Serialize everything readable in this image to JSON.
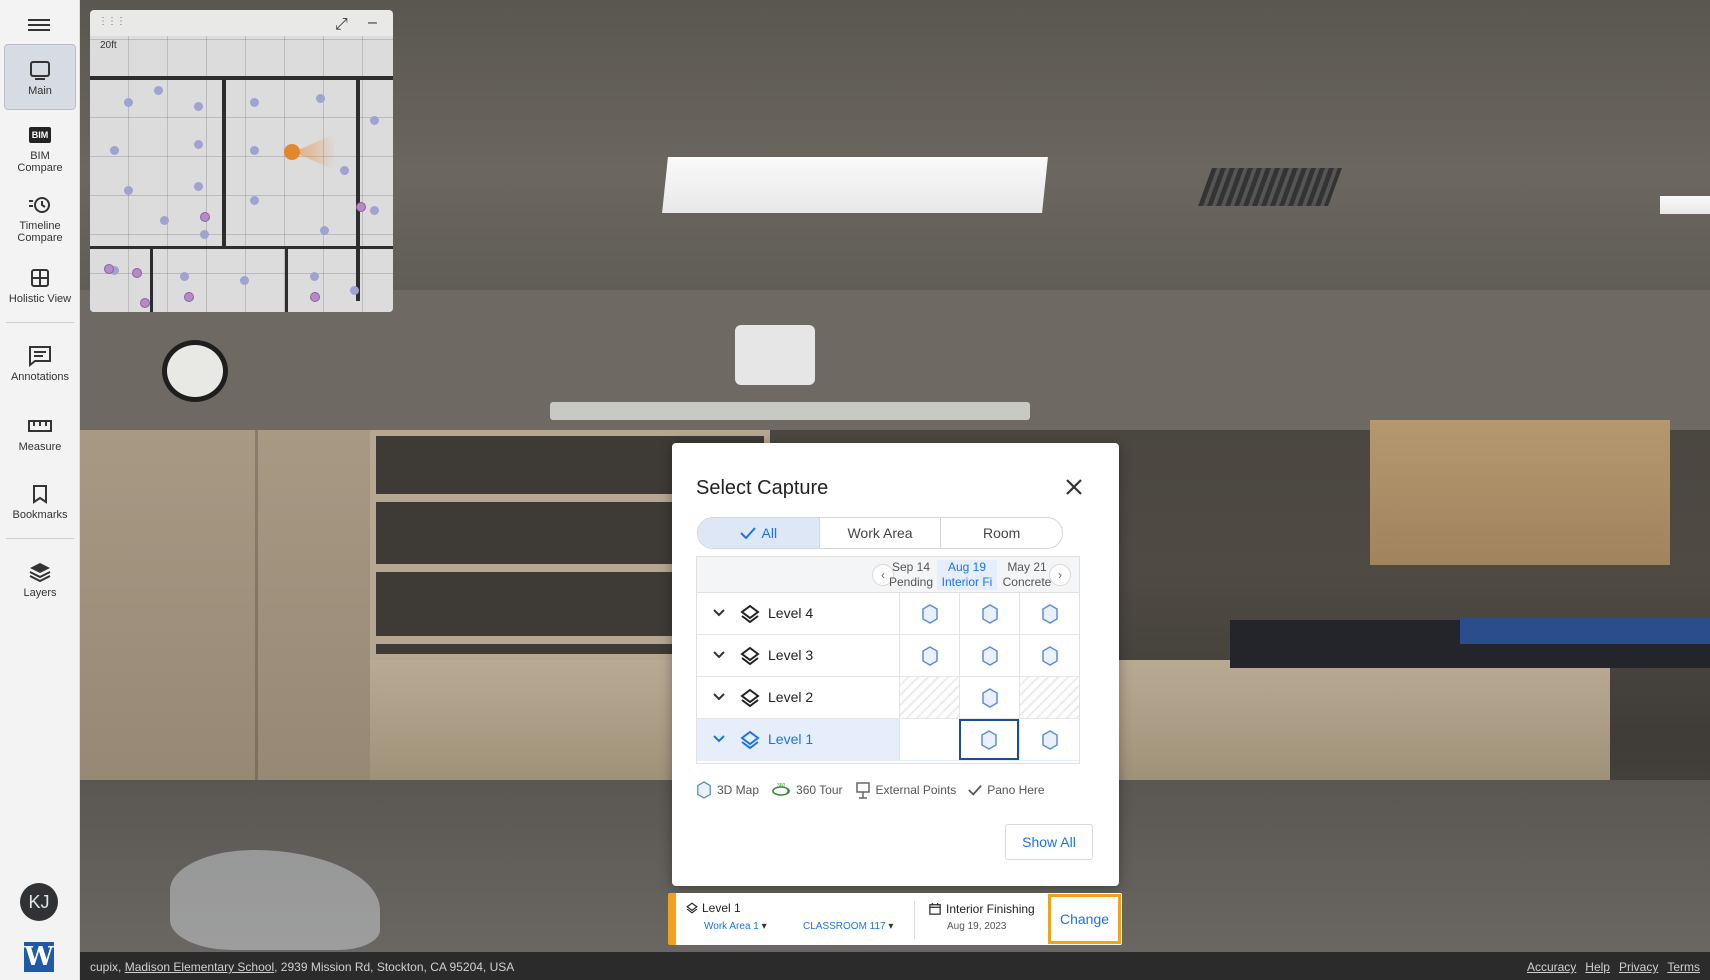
{
  "sidebar": {
    "items": [
      {
        "label": "Main",
        "icon": "square-icon"
      },
      {
        "label": "BIM\nCompare",
        "icon": "bim-icon",
        "badge": "BIM"
      },
      {
        "label": "Timeline\nCompare",
        "icon": "timeline-icon"
      },
      {
        "label": "Holistic View",
        "icon": "grid-icon"
      },
      {
        "label": "Annotations",
        "icon": "annotation-icon"
      },
      {
        "label": "Measure",
        "icon": "ruler-icon"
      },
      {
        "label": "Bookmarks",
        "icon": "bookmark-icon"
      },
      {
        "label": "Layers",
        "icon": "layers-icon"
      }
    ],
    "avatar": "KJ",
    "logo": "W"
  },
  "minimap": {
    "scale_label": "20ft"
  },
  "modal": {
    "title": "Select Capture",
    "tabs": [
      {
        "label": "All",
        "active": true
      },
      {
        "label": "Work Area",
        "active": false
      },
      {
        "label": "Room",
        "active": false
      }
    ],
    "columns": [
      {
        "date": "Sep 14",
        "phase": "Pending",
        "selected": false
      },
      {
        "date": "Aug 19",
        "phase": "Interior Fi",
        "selected": true
      },
      {
        "date": "May 21",
        "phase": "Concrete",
        "selected": false
      }
    ],
    "rows": [
      {
        "label": "Level 4",
        "cells": [
          "map",
          "map",
          "map"
        ],
        "selected": false
      },
      {
        "label": "Level 3",
        "cells": [
          "map",
          "map",
          "map"
        ],
        "selected": false
      },
      {
        "label": "Level 2",
        "cells": [
          "empty",
          "map",
          "empty"
        ],
        "selected": false
      },
      {
        "label": "Level 1",
        "cells": [
          "empty",
          "current",
          "map"
        ],
        "selected": true
      }
    ],
    "legend": {
      "map_3d": "3D Map",
      "tour_360": "360 Tour",
      "external_points": "External Points",
      "pano_here": "Pano Here"
    },
    "show_all": "Show All"
  },
  "capture_bar": {
    "level": "Level 1",
    "work_area": "Work Area 1",
    "room": "CLASSROOM 117",
    "phase": "Interior Finishing",
    "date": "Aug 19, 2023",
    "change": "Change"
  },
  "footer": {
    "company": "cupix,",
    "project": "Madison Elementary School",
    "address": ", 2939 Mission Rd, Stockton, CA 95204, USA",
    "links": [
      "Accuracy",
      "Help",
      "Privacy",
      "Terms"
    ]
  },
  "colors": {
    "accent": "#1a73e8",
    "highlight": "#f0a21e",
    "selected_bg": "#e6eefb"
  }
}
